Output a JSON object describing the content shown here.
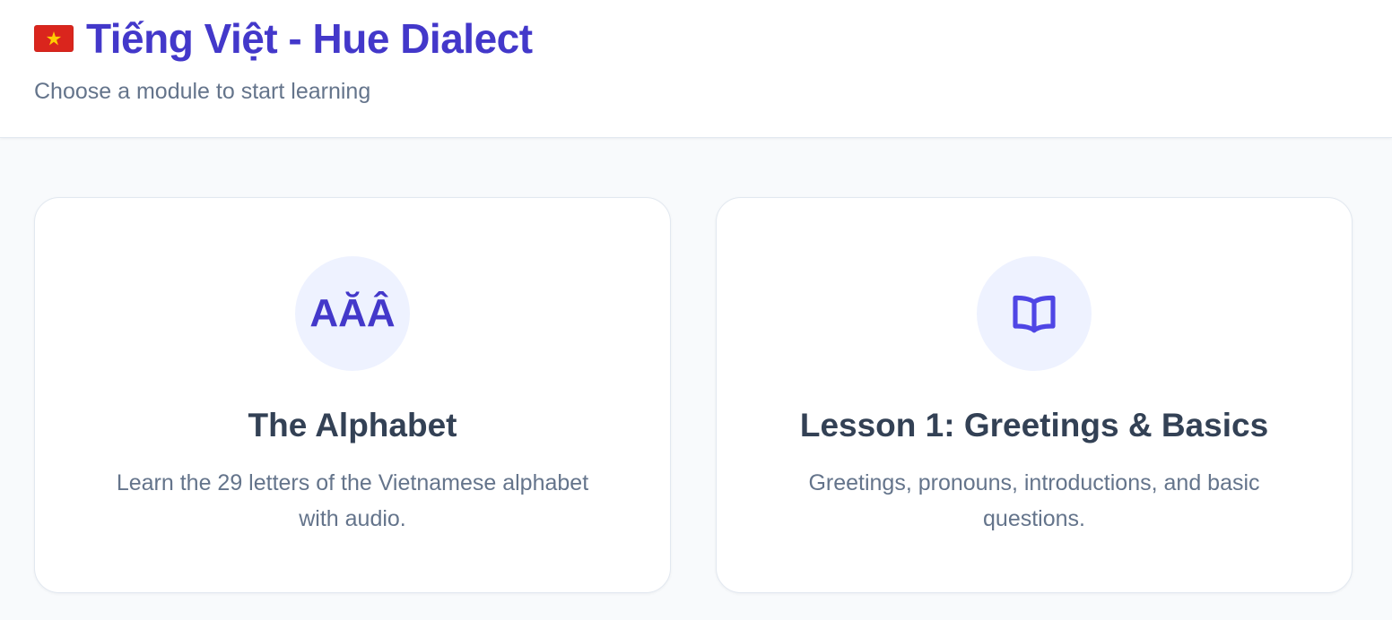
{
  "header": {
    "flag_icon": "vietnam-flag-icon",
    "title": "Tiếng Việt - Hue Dialect",
    "subtitle": "Choose a module to start learning"
  },
  "modules": [
    {
      "icon_text": "AĂÂ",
      "title": "The Alphabet",
      "description": "Learn the 29 letters of the Vietnamese alphabet with audio."
    },
    {
      "icon": "book-open-icon",
      "title": "Lesson 1: Greetings & Basics",
      "description": "Greetings, pronouns, introductions, and basic questions."
    }
  ],
  "colors": {
    "accent": "#4338ca",
    "icon_bg": "#eef2ff",
    "page_bg": "#f8fafc",
    "title_text": "#334155",
    "muted_text": "#64748b",
    "flag_red": "#da251d",
    "flag_star": "#ffcd00"
  }
}
